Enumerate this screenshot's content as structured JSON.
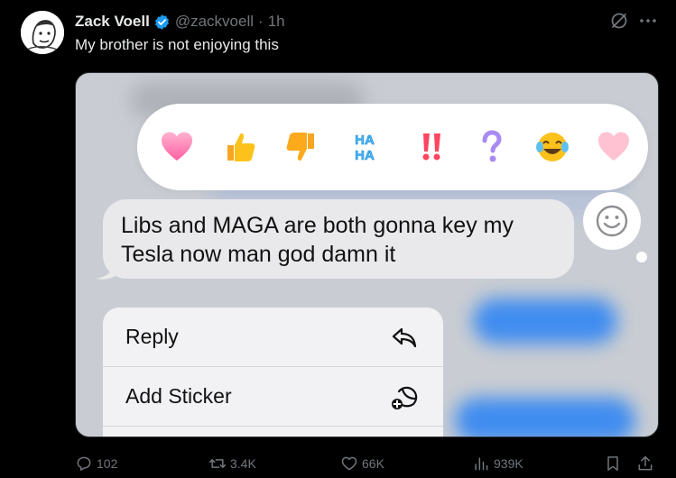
{
  "tweet": {
    "author_name": "Zack Voell",
    "author_handle": "@zackvoell",
    "separator": "·",
    "time": "1h",
    "text": "My brother is not enjoying this"
  },
  "media": {
    "reactions": [
      "heart",
      "thumbs-up",
      "thumbs-down",
      "haha",
      "double-exclamation",
      "question-mark",
      "crying-laughing-emoji",
      "heart"
    ],
    "haha_text": "HA HA",
    "message_lines": [
      "Libs and MAGA are both gonna key my",
      "Tesla now man god damn it"
    ],
    "menu": [
      {
        "label": "Reply",
        "icon": "reply-icon"
      },
      {
        "label": "Add Sticker",
        "icon": "sticker-icon"
      }
    ]
  },
  "actions": {
    "replies": "102",
    "reposts": "3.4K",
    "likes": "66K",
    "views": "939K"
  },
  "colors": {
    "background": "#000000",
    "text_primary": "#e7e9ea",
    "text_secondary": "#71767b",
    "verified_blue": "#1d9bf0"
  }
}
